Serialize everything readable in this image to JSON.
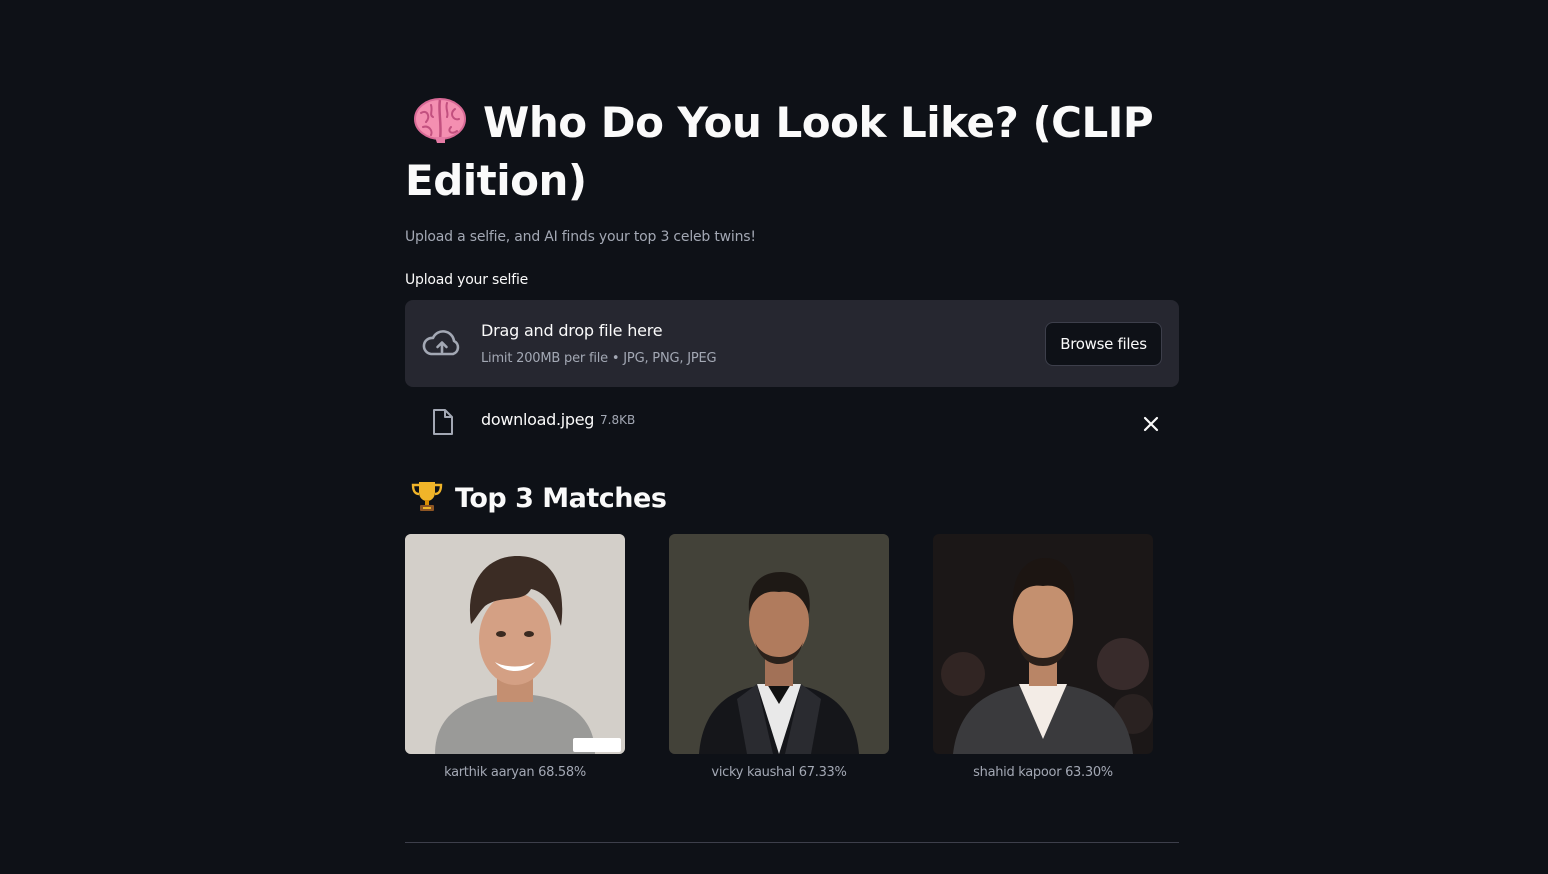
{
  "page": {
    "title": "Who Do You Look Like? (CLIP Edition)",
    "title_icon": "brain-emoji",
    "subtitle": "Upload a selfie, and AI finds your top 3 celeb twins!"
  },
  "uploader": {
    "label": "Upload your selfie",
    "drop_text": "Drag and drop file here",
    "limit_text": "Limit 200MB per file • JPG, PNG, JPEG",
    "browse_label": "Browse files",
    "icon": "cloud-upload-icon"
  },
  "uploaded_file": {
    "name": "download.jpeg",
    "size": "7.8KB",
    "icon": "file-icon"
  },
  "results": {
    "heading": "Top 3 Matches",
    "heading_icon": "trophy-emoji",
    "matches": [
      {
        "caption": "karthik aaryan 68.58%"
      },
      {
        "caption": "vicky kaushal 67.33%"
      },
      {
        "caption": "shahid kapoor 63.30%"
      }
    ]
  },
  "colors": {
    "background": "#0e1117",
    "surface": "#262730",
    "text": "#fafafa",
    "muted": "#a3a8b4",
    "border": "#3d3f4b"
  }
}
